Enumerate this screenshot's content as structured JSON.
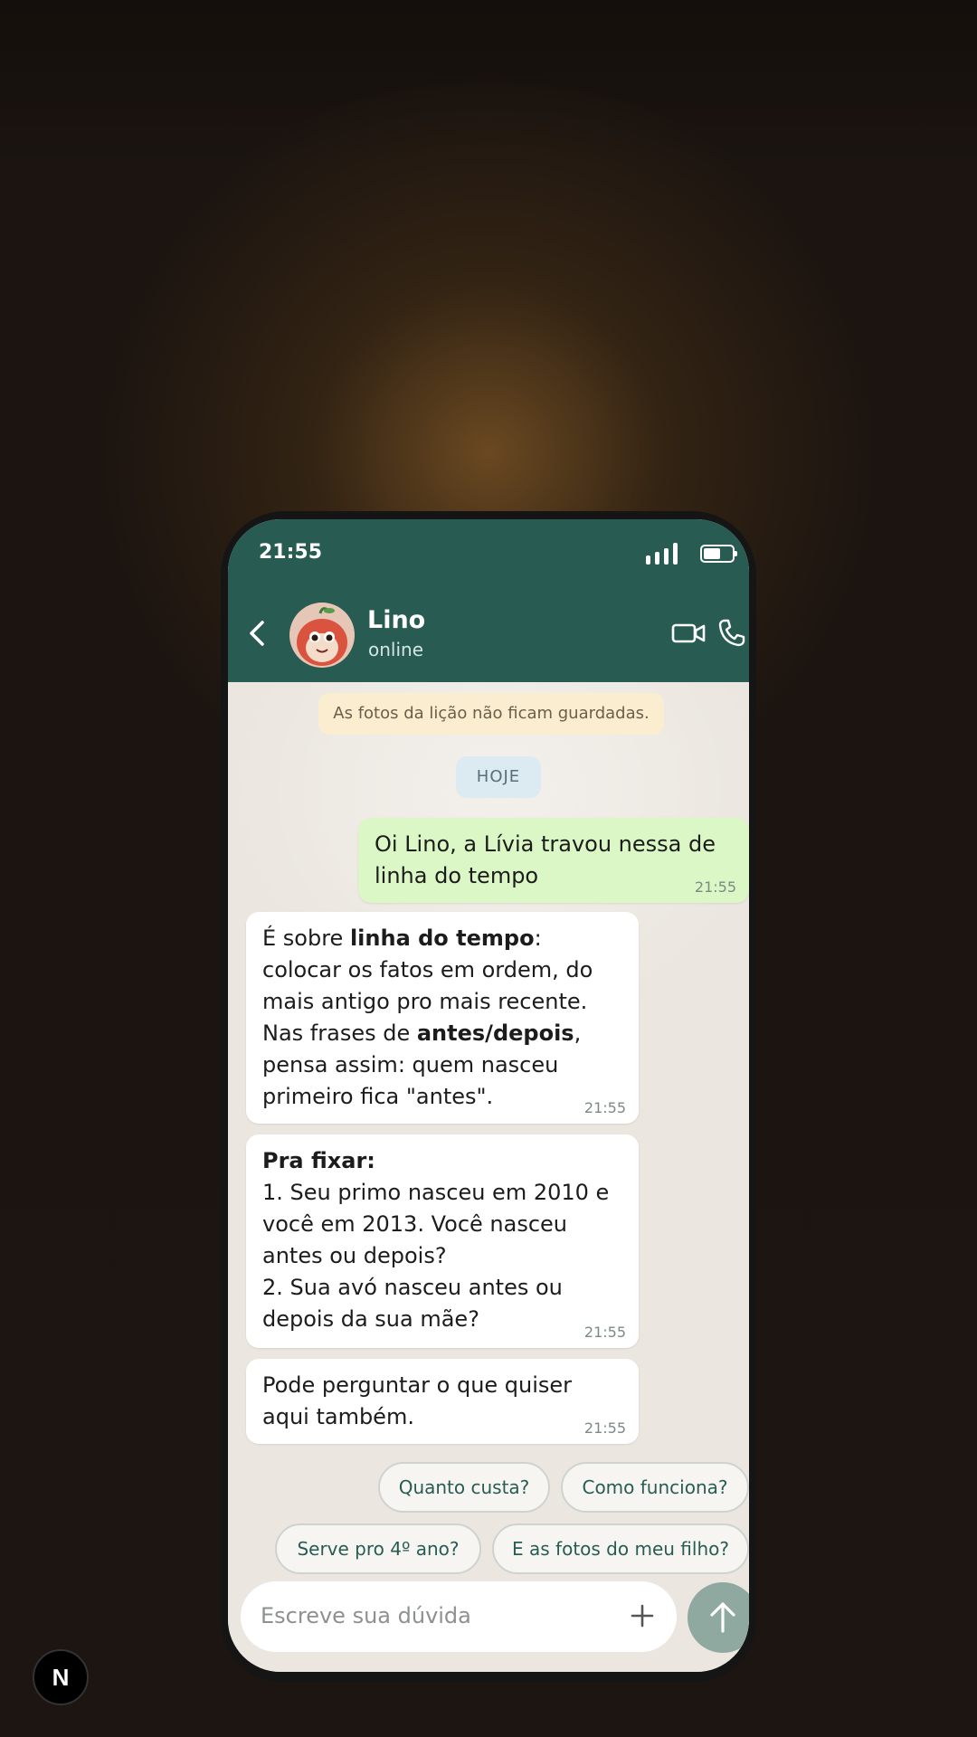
{
  "status_bar": {
    "time": "21:55"
  },
  "contact": {
    "name": "Lino",
    "status": "online"
  },
  "notice": "As fotos da lição não ficam guardadas.",
  "day_label": "HOJE",
  "messages": [
    {
      "direction": "out",
      "text": "Oi Lino, a Lívia travou nessa de linha do tempo",
      "time": "21:55"
    },
    {
      "direction": "in",
      "parts": [
        "É sobre ",
        "linha do tempo",
        ": colocar os fatos em ordem, do mais antigo pro mais recente. Nas frases de ",
        "antes/depois",
        ", pensa assim: quem nasceu primeiro fica \"antes\"."
      ],
      "time": "21:55"
    },
    {
      "direction": "in",
      "title": "Pra fixar:",
      "lines": [
        "1. Seu primo nasceu em 2010 e você em 2013. Você nasceu antes ou depois?",
        "2. Sua avó nasceu antes ou depois da sua mãe?"
      ],
      "time": "21:55"
    },
    {
      "direction": "in",
      "text": "Pode perguntar o que quiser aqui também.",
      "time": "21:55"
    }
  ],
  "quick_replies": [
    "Quanto custa?",
    "Como funciona?",
    "Serve pro 4º ano?",
    "E as fotos do meu filho?"
  ],
  "composer": {
    "placeholder": "Escreve sua dúvida"
  },
  "badge": {
    "letter": "N"
  },
  "colors": {
    "header": "#285c53",
    "outgoing": "#dcf7c6",
    "incoming": "#ffffff",
    "send": "#8fa8a0"
  },
  "icons": [
    "back-arrow-icon",
    "video-call-icon",
    "phone-icon",
    "plus-icon",
    "send-arrow-icon"
  ]
}
